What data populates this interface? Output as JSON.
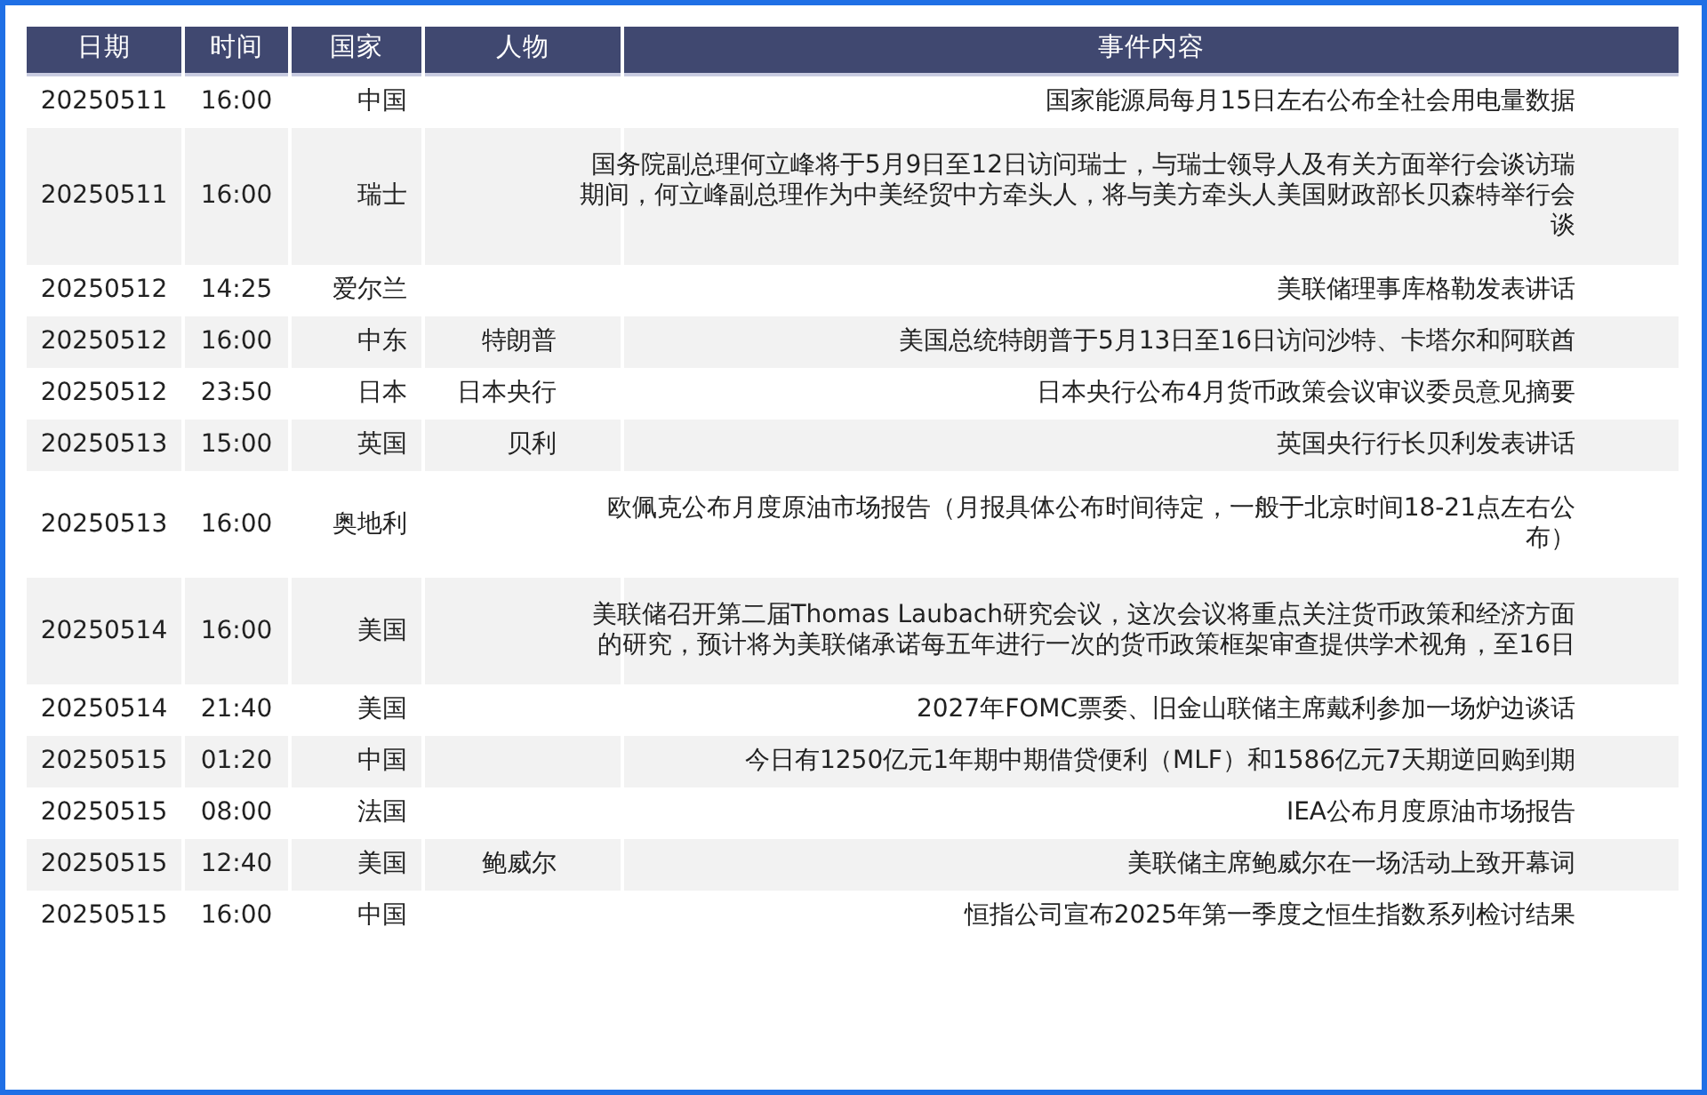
{
  "table": {
    "columns": [
      "日期",
      "时间",
      "国家",
      "人物",
      "事件内容"
    ],
    "rows": [
      {
        "date": "20250511",
        "time": "16:00",
        "country": "中国",
        "person": "",
        "event": "国家能源局每月15日左右公布全社会用电量数据"
      },
      {
        "date": "20250511",
        "time": "16:00",
        "country": "瑞士",
        "person": "",
        "event": "国务院副总理何立峰将于5月9日至12日访问瑞士，与瑞士领导人及有关方面举行会谈访瑞期间，何立峰副总理作为中美经贸中方牵头人，将与美方牵头人美国财政部长贝森特举行会谈"
      },
      {
        "date": "20250512",
        "time": "14:25",
        "country": "爱尔兰",
        "person": "",
        "event": "美联储理事库格勒发表讲话"
      },
      {
        "date": "20250512",
        "time": "16:00",
        "country": "中东",
        "person": "特朗普",
        "event": "美国总统特朗普于5月13日至16日访问沙特、卡塔尔和阿联酋"
      },
      {
        "date": "20250512",
        "time": "23:50",
        "country": "日本",
        "person": "日本央行",
        "event": "日本央行公布4月货币政策会议审议委员意见摘要"
      },
      {
        "date": "20250513",
        "time": "15:00",
        "country": "英国",
        "person": "贝利",
        "event": "英国央行行长贝利发表讲话"
      },
      {
        "date": "20250513",
        "time": "16:00",
        "country": "奥地利",
        "person": "",
        "event": "欧佩克公布月度原油市场报告（月报具体公布时间待定，一般于北京时间18-21点左右公布）"
      },
      {
        "date": "20250514",
        "time": "16:00",
        "country": "美国",
        "person": "",
        "event": "美联储召开第二届Thomas Laubach研究会议，这次会议将重点关注货币政策和经济方面的研究，预计将为美联储承诺每五年进行一次的货币政策框架审查提供学术视角，至16日"
      },
      {
        "date": "20250514",
        "time": "21:40",
        "country": "美国",
        "person": "",
        "event": "2027年FOMC票委、旧金山联储主席戴利参加一场炉边谈话"
      },
      {
        "date": "20250515",
        "time": "01:20",
        "country": "中国",
        "person": "",
        "event": "今日有1250亿元1年期中期借贷便利（MLF）和1586亿元7天期逆回购到期"
      },
      {
        "date": "20250515",
        "time": "08:00",
        "country": "法国",
        "person": "",
        "event": "IEA公布月度原油市场报告"
      },
      {
        "date": "20250515",
        "time": "12:40",
        "country": "美国",
        "person": "鲍威尔",
        "event": "美联储主席鲍威尔在一场活动上致开幕词"
      },
      {
        "date": "20250515",
        "time": "16:00",
        "country": "中国",
        "person": "",
        "event": "恒指公司宣布2025年第一季度之恒生指数系列检讨结果"
      }
    ]
  }
}
